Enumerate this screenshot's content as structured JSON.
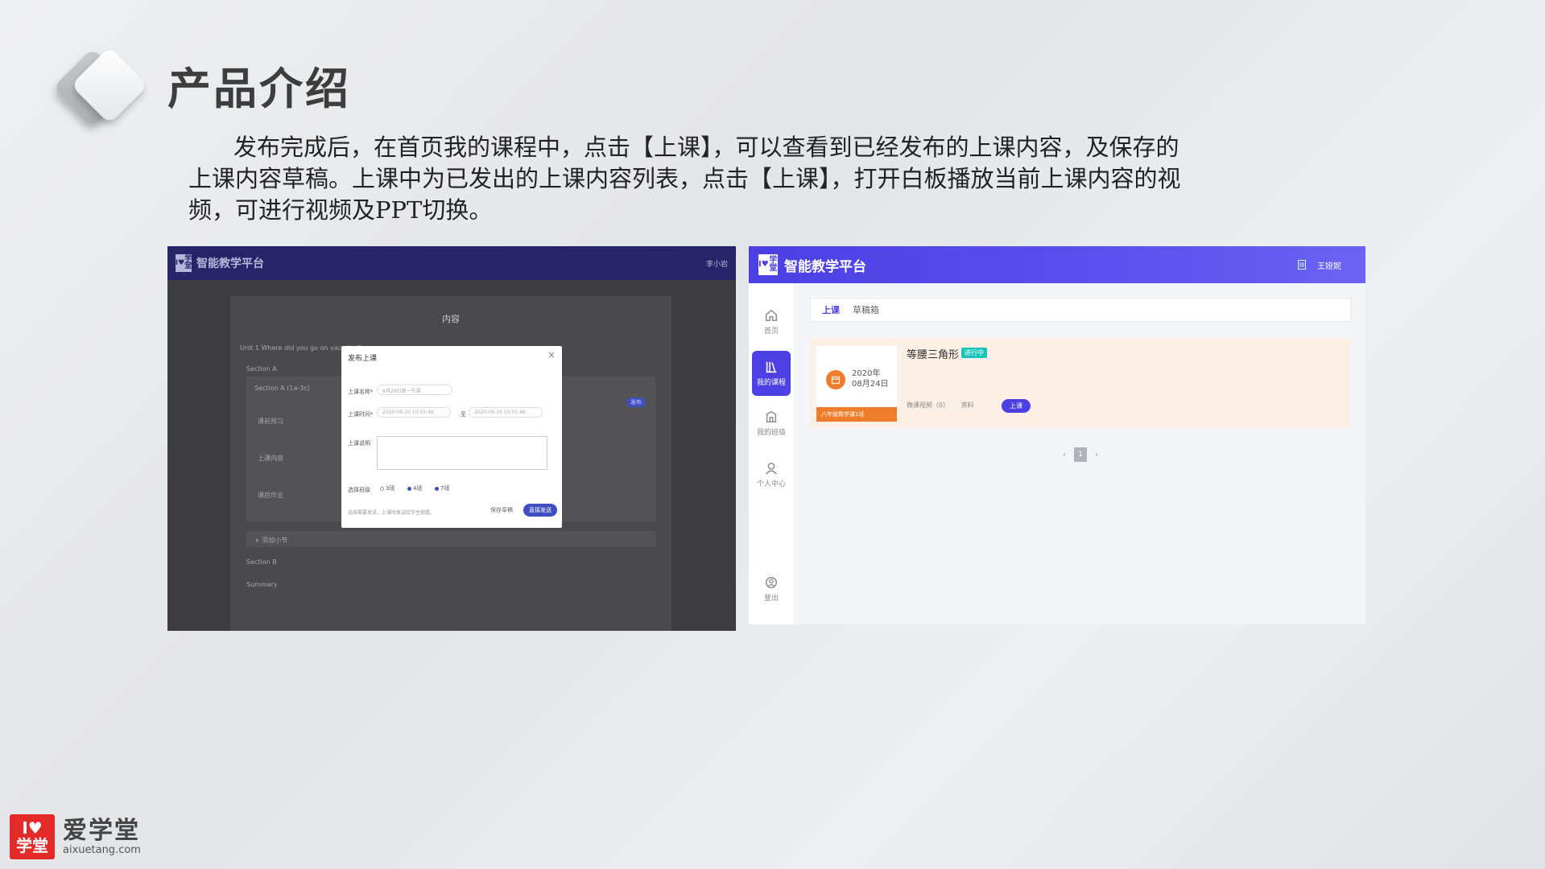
{
  "slide": {
    "title": "产品介绍",
    "desc_line1": "发布完成后，在首页我的课程中，点击【上课】，可以查看到已经发布的上课内容，及保存的",
    "desc_line2": "上课内容草稿。上课中为已发出的上课内容列表，点击【上课】，打开白板播放当前上课内容的视",
    "desc_line3": "频，可进行视频及PPT切换。"
  },
  "left_shot": {
    "brand": "智能教学平台",
    "logo_top": "I♥",
    "logo_bottom": "学堂",
    "user": "李小岩",
    "panel_title": "内容",
    "unit": "Unit 1 Where did you go on vacation?",
    "section_a": "Section A",
    "section_a_sub": "Section A (1a-3c)",
    "section_b": "Section B",
    "summary": "Summary",
    "add_sub": "+ 添加小节",
    "badge": "发布",
    "row_preview": "课前预习",
    "row_content": "上课内容",
    "row_homework": "课后作业",
    "modal": {
      "title": "发布上课",
      "close": "×",
      "name_label": "上课名称*",
      "name_placeholder": "8月20日第一节课",
      "time_label": "上课时间*",
      "time_start": "2020-08-20 10:55:48",
      "time_to": "至",
      "time_end": "2020-08-20 10:55:48",
      "desc_label": "上课说明",
      "class_label": "选择班级",
      "class_opts": [
        "3班",
        "4班",
        "7班"
      ],
      "note": "选择需要发送，上课时发送给学生观看。",
      "save": "保存草稿",
      "publish": "直接发送"
    }
  },
  "right_shot": {
    "brand": "智能教学平台",
    "logo_top": "I♥",
    "logo_bottom": "学堂",
    "user": "王娅妮",
    "nav": {
      "home": "首页",
      "courses": "我的课程",
      "classes": "我的班级",
      "profile": "个人中心",
      "logout": "登出"
    },
    "tabs": [
      "上课",
      "草稿箱"
    ],
    "card": {
      "year": "2020年",
      "date": "08月24日",
      "tag": "八年级数学课1班",
      "title": "等腰三角形",
      "status": "进行中",
      "meta_video": "微课视频（0）",
      "meta_material": "资料",
      "action": "上课"
    },
    "pager": {
      "prev": "‹",
      "page": "1",
      "next": "›"
    }
  },
  "footer": {
    "mark_top": "I♥",
    "mark_bottom": "学堂",
    "name": "爱学堂",
    "url": "aixuetang.com"
  },
  "colors": {
    "brand_purple": "#4c3fe3",
    "card_orange": "#f07d2b",
    "status_teal": "#19c3b8",
    "logo_red": "#e52a2a"
  }
}
